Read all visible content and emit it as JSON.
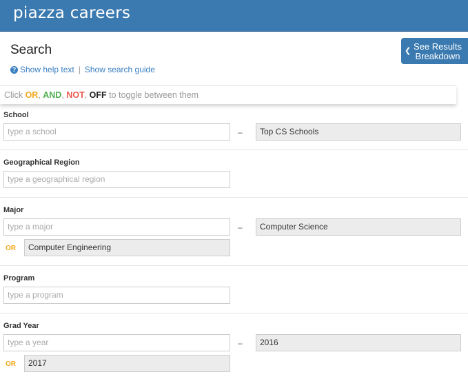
{
  "header": {
    "logo_text": "piazza careers"
  },
  "search": {
    "title": "Search",
    "help_link": "Show help text",
    "guide_link": "Show search guide",
    "results_button": "See Results Breakdown"
  },
  "toggle_hint": {
    "prefix": "Click ",
    "or": "OR",
    "comma1": ", ",
    "and": "AND",
    "comma2": ", ",
    "not": "NOT",
    "comma3": ", ",
    "off": "OFF",
    "suffix": " to toggle between them"
  },
  "sections": {
    "school": {
      "label": "School",
      "placeholder": "type a school",
      "dash": "–",
      "selected": "Top CS Schools"
    },
    "region": {
      "label": "Geographical Region",
      "placeholder": "type a geographical region"
    },
    "major": {
      "label": "Major",
      "placeholder": "type a major",
      "dash": "–",
      "selected": "Computer Science",
      "or_label": "OR",
      "or_value": "Computer Engineering"
    },
    "program": {
      "label": "Program",
      "placeholder": "type a program"
    },
    "grad_year": {
      "label": "Grad Year",
      "placeholder": "type a year",
      "dash": "–",
      "selected": "2016",
      "or_label": "OR",
      "or_value": "2017"
    }
  },
  "colors": {
    "brand": "#3b7ab0",
    "link": "#3a7fc1",
    "or": "#f2a81d",
    "and": "#4caf50",
    "not": "#e85a4f"
  }
}
